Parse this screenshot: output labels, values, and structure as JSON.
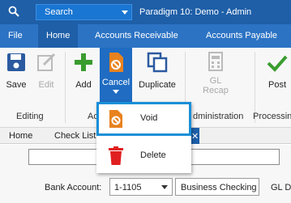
{
  "titlebar": {
    "search_label": "Search",
    "app_title": "Paradigm 10: Demo - Admin"
  },
  "menu": [
    "File",
    "Home",
    "Accounts Receivable",
    "Accounts Payable"
  ],
  "ribbon": {
    "save": "Save",
    "edit": "Edit",
    "add": "Add",
    "cancel": "Cancel",
    "duplicate": "Duplicate",
    "gl_recap_line1": "GL",
    "gl_recap_line2": "Recap",
    "post": "Post",
    "groups": {
      "editing": "Editing",
      "actions_partial": "Ac",
      "administration_partial": "dministration",
      "processing_partial": "Processin"
    }
  },
  "tabs": [
    "Home",
    "Check List",
    ""
  ],
  "form": {
    "bank_account_label": "Bank Account:",
    "bank_account_value": "1-1105",
    "bank_account_name": "Business Checking",
    "gl_label_partial": "GL D"
  },
  "dropdown": {
    "items": [
      "Void",
      "Delete"
    ]
  },
  "colors": {
    "titlebar": "#1e5fa8",
    "menubar": "#2c73c4",
    "accent_orange": "#e8821e",
    "delete_red": "#e02020",
    "highlight_border": "#1a8fd8"
  }
}
